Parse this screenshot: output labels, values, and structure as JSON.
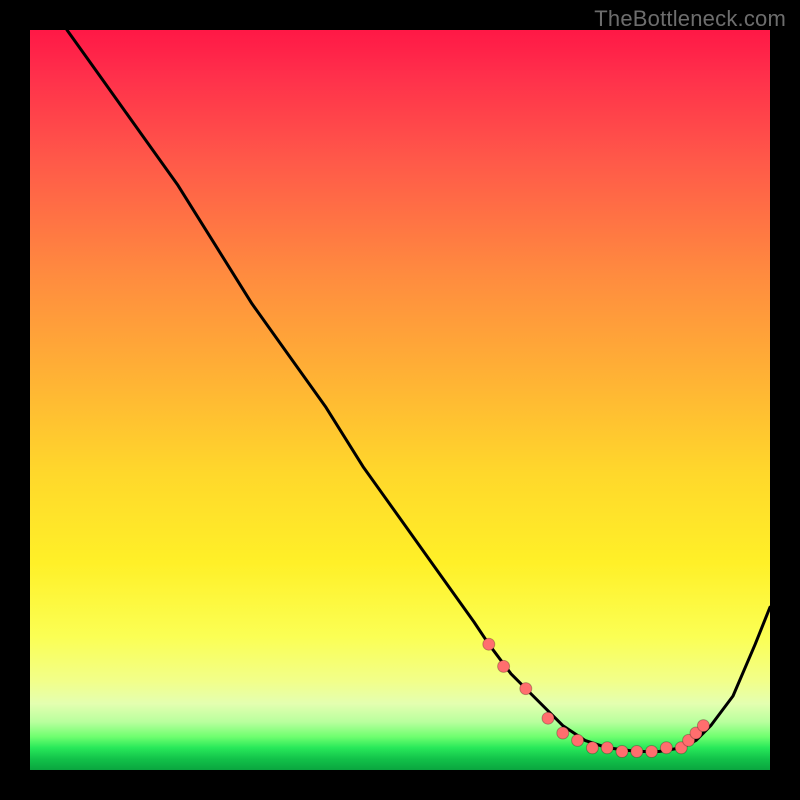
{
  "watermark": "TheBottleneck.com",
  "colors": {
    "curve": "#000000",
    "marker": "#ff6e6e",
    "background_top": "#ff1846",
    "background_bottom": "#0aa53f"
  },
  "chart_data": {
    "type": "line",
    "title": "",
    "xlabel": "",
    "ylabel": "",
    "xlim": [
      0,
      100
    ],
    "ylim": [
      0,
      100
    ],
    "grid": false,
    "note": "No axis ticks or numeric labels are shown; values below are estimates from the curve shape on a normalized 0–100 scale.",
    "series": [
      {
        "name": "curve",
        "x": [
          5,
          10,
          15,
          20,
          25,
          30,
          35,
          40,
          45,
          50,
          55,
          60,
          62,
          65,
          68,
          72,
          75,
          78,
          82,
          85,
          88,
          90,
          92,
          95,
          98,
          100
        ],
        "y": [
          100,
          93,
          86,
          79,
          71,
          63,
          56,
          49,
          41,
          34,
          27,
          20,
          17,
          13,
          10,
          6,
          4,
          3,
          2.5,
          2.5,
          3,
          4,
          6,
          10,
          17,
          22
        ]
      }
    ],
    "markers": {
      "name": "highlighted-points",
      "x": [
        62,
        64,
        67,
        70,
        72,
        74,
        76,
        78,
        80,
        82,
        84,
        86,
        88,
        89,
        90,
        91
      ],
      "y": [
        17,
        14,
        11,
        7,
        5,
        4,
        3,
        3,
        2.5,
        2.5,
        2.5,
        3,
        3,
        4,
        5,
        6
      ]
    }
  }
}
